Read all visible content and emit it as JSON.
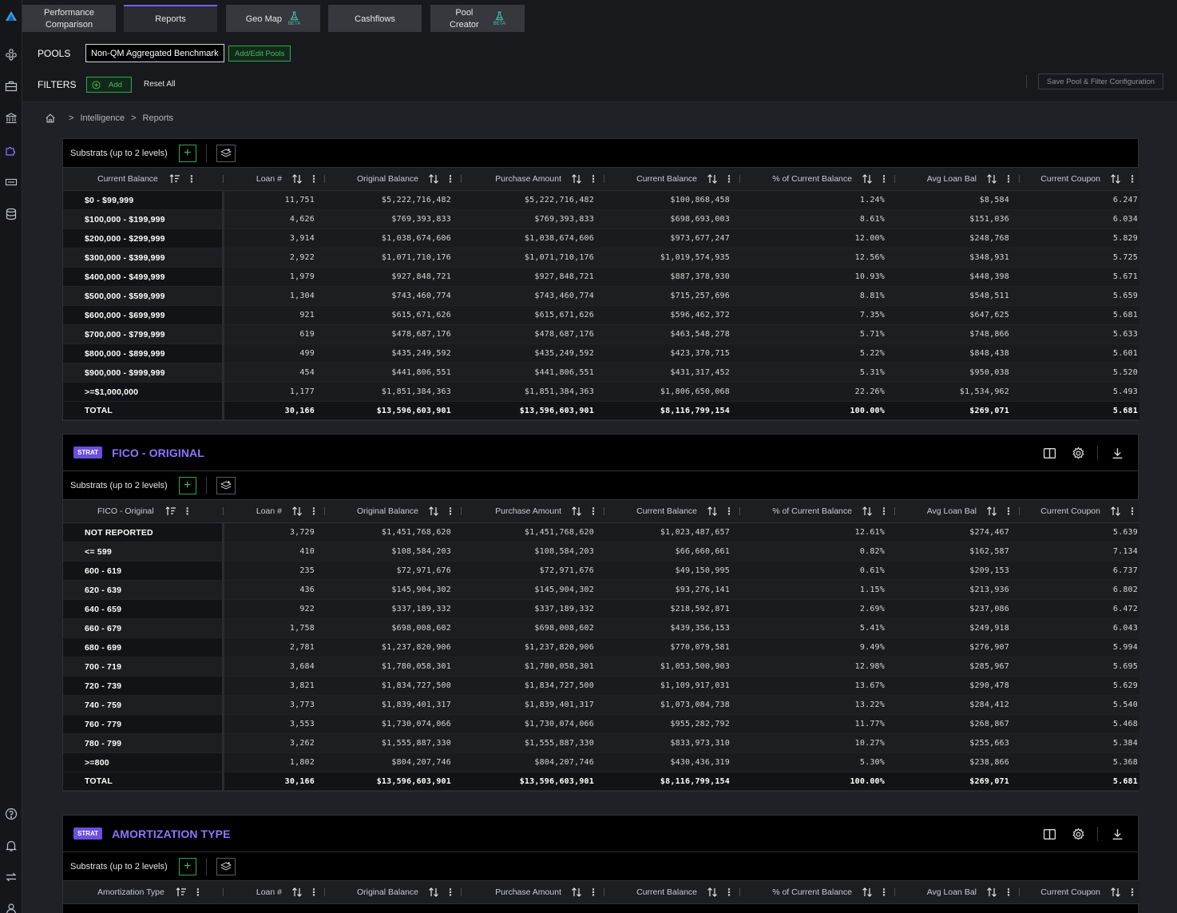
{
  "tabs": [
    {
      "label": "Performance\nComparison",
      "beta": ""
    },
    {
      "label": "Reports",
      "beta": ""
    },
    {
      "label": "Geo Map",
      "beta": "BETA"
    },
    {
      "label": "Cashflows",
      "beta": ""
    },
    {
      "label": "Pool\nCreator",
      "beta": "BETA"
    }
  ],
  "pools": {
    "label": "POOLS",
    "chip": "Non-QM Aggregated Benchmark",
    "edit_label": "Add/Edit Pools"
  },
  "filters": {
    "label": "FILTERS",
    "add_label": "Add",
    "reset_label": "Reset All",
    "save_label": "Save Pool & Filter Configuration"
  },
  "breadcrumb": [
    "Intelligence",
    "Reports"
  ],
  "substrat_label": "Substrats (up to 2 levels)",
  "strat_badge": "STRAT",
  "columns": [
    "Loan #",
    "Original Balance",
    "Purchase Amount",
    "Current Balance",
    "% of Current Balance",
    "Avg Loan Bal",
    "Current Coupon"
  ],
  "panels": [
    {
      "title": "",
      "first_col": "Current Balance",
      "rows": [
        [
          "$0 - $99,999",
          "11,751",
          "$5,222,716,482",
          "$5,222,716,482",
          "$100,868,458",
          "1.24%",
          "$8,584",
          "6.247"
        ],
        [
          "$100,000 - $199,999",
          "4,626",
          "$769,393,833",
          "$769,393,833",
          "$698,693,003",
          "8.61%",
          "$151,036",
          "6.034"
        ],
        [
          "$200,000 - $299,999",
          "3,914",
          "$1,038,674,606",
          "$1,038,674,606",
          "$973,677,247",
          "12.00%",
          "$248,768",
          "5.829"
        ],
        [
          "$300,000 - $399,999",
          "2,922",
          "$1,071,710,176",
          "$1,071,710,176",
          "$1,019,574,935",
          "12.56%",
          "$348,931",
          "5.725"
        ],
        [
          "$400,000 - $499,999",
          "1,979",
          "$927,848,721",
          "$927,848,721",
          "$887,378,930",
          "10.93%",
          "$448,398",
          "5.671"
        ],
        [
          "$500,000 - $599,999",
          "1,304",
          "$743,460,774",
          "$743,460,774",
          "$715,257,696",
          "8.81%",
          "$548,511",
          "5.659"
        ],
        [
          "$600,000 - $699,999",
          "921",
          "$615,671,626",
          "$615,671,626",
          "$596,462,372",
          "7.35%",
          "$647,625",
          "5.681"
        ],
        [
          "$700,000 - $799,999",
          "619",
          "$478,687,176",
          "$478,687,176",
          "$463,548,278",
          "5.71%",
          "$748,866",
          "5.633"
        ],
        [
          "$800,000 - $899,999",
          "499",
          "$435,249,592",
          "$435,249,592",
          "$423,370,715",
          "5.22%",
          "$848,438",
          "5.601"
        ],
        [
          "$900,000 - $999,999",
          "454",
          "$441,806,551",
          "$441,806,551",
          "$431,317,452",
          "5.31%",
          "$950,038",
          "5.520"
        ],
        [
          ">=$1,000,000",
          "1,177",
          "$1,851,384,363",
          "$1,851,384,363",
          "$1,806,650,068",
          "22.26%",
          "$1,534,962",
          "5.493"
        ],
        [
          "TOTAL",
          "30,166",
          "$13,596,603,901",
          "$13,596,603,901",
          "$8,116,799,154",
          "100.00%",
          "$269,071",
          "5.681"
        ]
      ]
    },
    {
      "title": "FICO - ORIGINAL",
      "first_col": "FICO - Original",
      "rows": [
        [
          "NOT REPORTED",
          "3,729",
          "$1,451,768,620",
          "$1,451,768,620",
          "$1,023,487,657",
          "12.61%",
          "$274,467",
          "5.639"
        ],
        [
          "<= 599",
          "410",
          "$108,584,203",
          "$108,584,203",
          "$66,660,661",
          "0.82%",
          "$162,587",
          "7.134"
        ],
        [
          "600 - 619",
          "235",
          "$72,971,676",
          "$72,971,676",
          "$49,150,995",
          "0.61%",
          "$209,153",
          "6.737"
        ],
        [
          "620 - 639",
          "436",
          "$145,904,302",
          "$145,904,302",
          "$93,276,141",
          "1.15%",
          "$213,936",
          "6.802"
        ],
        [
          "640 - 659",
          "922",
          "$337,189,332",
          "$337,189,332",
          "$218,592,871",
          "2.69%",
          "$237,086",
          "6.472"
        ],
        [
          "660 - 679",
          "1,758",
          "$698,008,602",
          "$698,008,602",
          "$439,356,153",
          "5.41%",
          "$249,918",
          "6.043"
        ],
        [
          "680 - 699",
          "2,781",
          "$1,237,820,906",
          "$1,237,820,906",
          "$770,079,581",
          "9.49%",
          "$276,907",
          "5.994"
        ],
        [
          "700 - 719",
          "3,684",
          "$1,780,058,301",
          "$1,780,058,301",
          "$1,053,500,903",
          "12.98%",
          "$285,967",
          "5.695"
        ],
        [
          "720 - 739",
          "3,821",
          "$1,834,727,500",
          "$1,834,727,500",
          "$1,109,917,031",
          "13.67%",
          "$290,478",
          "5.629"
        ],
        [
          "740 - 759",
          "3,773",
          "$1,839,401,317",
          "$1,839,401,317",
          "$1,073,084,738",
          "13.22%",
          "$284,412",
          "5.540"
        ],
        [
          "760 - 779",
          "3,553",
          "$1,730,074,066",
          "$1,730,074,066",
          "$955,282,792",
          "11.77%",
          "$268,867",
          "5.468"
        ],
        [
          "780 - 799",
          "3,262",
          "$1,555,887,330",
          "$1,555,887,330",
          "$833,973,310",
          "10.27%",
          "$255,663",
          "5.384"
        ],
        [
          ">=800",
          "1,802",
          "$804,207,746",
          "$804,207,746",
          "$430,436,319",
          "5.30%",
          "$238,866",
          "5.368"
        ],
        [
          "TOTAL",
          "30,166",
          "$13,596,603,901",
          "$13,596,603,901",
          "$8,116,799,154",
          "100.00%",
          "$269,071",
          "5.681"
        ]
      ]
    },
    {
      "title": "AMORTIZATION TYPE",
      "first_col": "Amortization Type",
      "rows": []
    }
  ]
}
